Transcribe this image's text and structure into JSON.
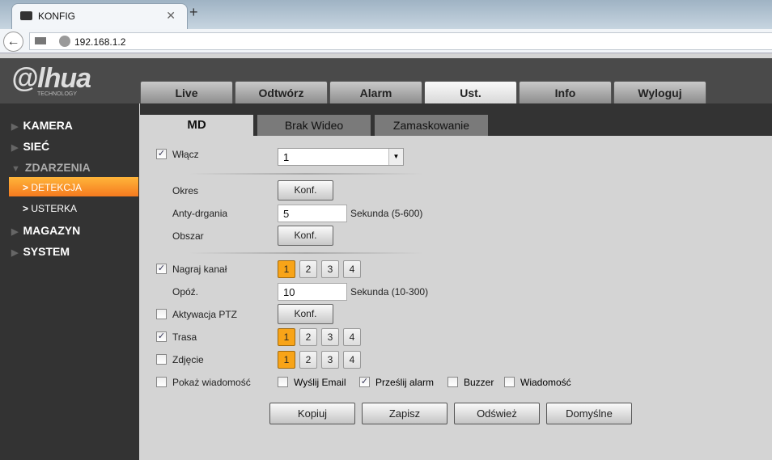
{
  "browser": {
    "tab_title": "KONFIG",
    "url": "192.168.1.2"
  },
  "logo": {
    "text": "alhua",
    "sub": "TECHNOLOGY"
  },
  "main_tabs": [
    "Live",
    "Odtwórz",
    "Alarm",
    "Ust.",
    "Info",
    "Wyloguj"
  ],
  "active_main_tab": "Ust.",
  "sidebar": {
    "items": [
      "KAMERA",
      "SIEĆ",
      "ZDARZENIA",
      "MAGAZYN",
      "SYSTEM"
    ],
    "sub": [
      "DETEKCJA",
      "USTERKA"
    ]
  },
  "sub_tabs": [
    "MD",
    "Brak Wideo",
    "Zamaskowanie"
  ],
  "form": {
    "enable_label": "Włącz",
    "channel_value": "1",
    "period_label": "Okres",
    "konf": "Konf.",
    "anti_label": "Anty-drgania",
    "anti_value": "5",
    "anti_hint": "Sekunda (5-600)",
    "area_label": "Obszar",
    "record_label": "Nagraj kanał",
    "delay_label": "Opóź.",
    "delay_value": "10",
    "delay_hint": "Sekunda (10-300)",
    "ptz_label": "Aktywacja PTZ",
    "tour_label": "Trasa",
    "snapshot_label": "Zdjęcie",
    "show_msg_label": "Pokaż wiadomość",
    "email_label": "Wyślij Email",
    "upload_label": "Prześlij alarm",
    "buzzer_label": "Buzzer",
    "message_label": "Wiadomość",
    "channels": [
      "1",
      "2",
      "3",
      "4"
    ]
  },
  "buttons": {
    "copy": "Kopiuj",
    "save": "Zapisz",
    "refresh": "Odśwież",
    "default": "Domyślne"
  },
  "checks": {
    "enable": true,
    "record": true,
    "ptz": false,
    "tour": true,
    "snapshot": false,
    "show_msg": false,
    "email": false,
    "upload": true,
    "buzzer": false,
    "message": false
  },
  "colors": {
    "accent": "#f8a418",
    "sidebar": "#333333"
  }
}
